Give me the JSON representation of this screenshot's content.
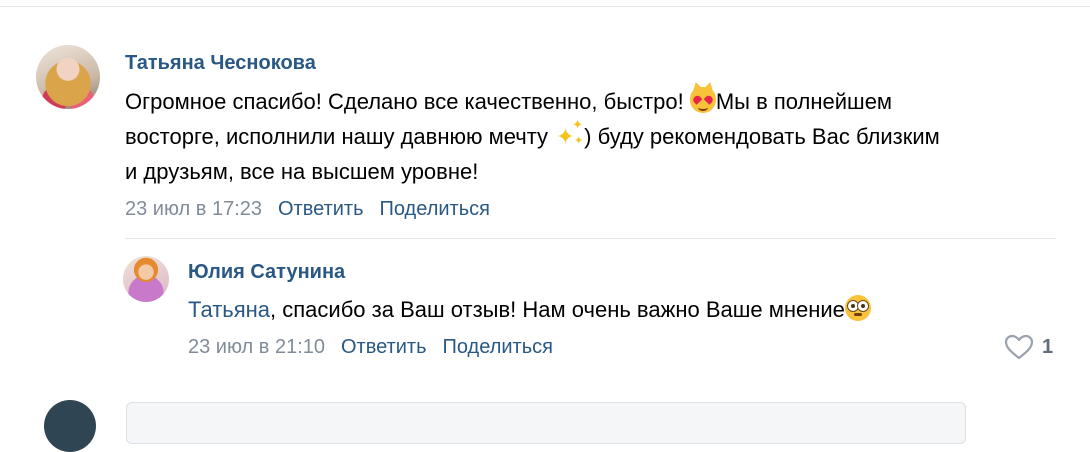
{
  "comment": {
    "author": "Татьяна Чеснокова",
    "text_1": "Огромное спасибо! Сделано все качественно, быстро! ",
    "emoji_1": "heart-eyes-cat",
    "text_2": "Мы в полнейшем восторге, исполнили нашу давнюю мечту ",
    "emoji_2": "sparkles",
    "text_3": ") буду рекомендовать Вас близким и друзьям, все на высшем уровне!",
    "date": "23 июл в 17:23",
    "reply_label": "Ответить",
    "share_label": "Поделиться"
  },
  "reply": {
    "author": "Юлия Сатунина",
    "mention": "Татьяна",
    "text": ", спасибо за Ваш отзыв! Нам очень важно Ваше мнение",
    "emoji": "dazed-face",
    "date": "23 июл в 21:10",
    "reply_label": "Ответить",
    "share_label": "Поделиться",
    "likes": "1"
  },
  "colors": {
    "link": "#2a5885",
    "meta": "#818c99",
    "divider": "#e7e8ec"
  }
}
